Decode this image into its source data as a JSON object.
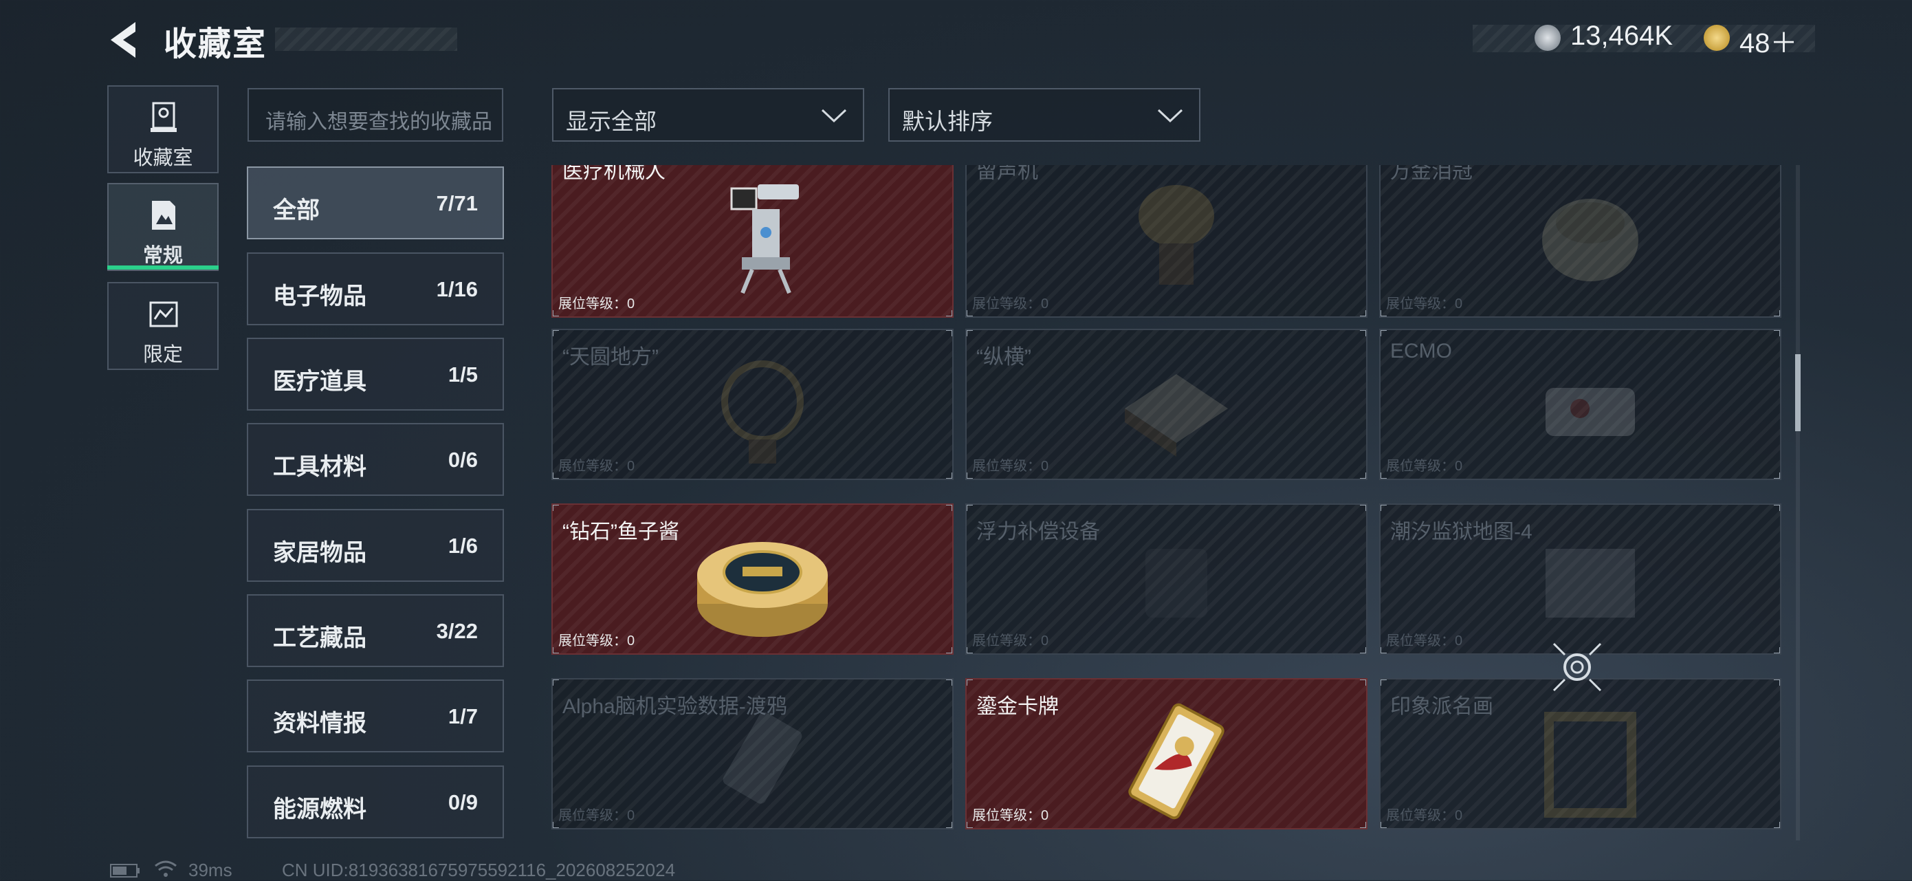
{
  "header": {
    "title": "收藏室",
    "currency_silver": "13,464K",
    "currency_gold": "48＋"
  },
  "nav": {
    "tabs": [
      {
        "label": "收藏室",
        "icon": "collection-room-icon"
      },
      {
        "label": "常规",
        "icon": "regular-icon",
        "active": true
      },
      {
        "label": "限定",
        "icon": "limited-icon"
      }
    ]
  },
  "search": {
    "placeholder": "请输入想要查找的收藏品"
  },
  "filters": {
    "display": "显示全部",
    "sort": "默认排序"
  },
  "categories": [
    {
      "name": "全部",
      "count": "7/71",
      "active": true
    },
    {
      "name": "电子物品",
      "count": "1/16"
    },
    {
      "name": "医疗道具",
      "count": "1/5"
    },
    {
      "name": "工具材料",
      "count": "0/6"
    },
    {
      "name": "家居物品",
      "count": "1/6"
    },
    {
      "name": "工艺藏品",
      "count": "3/22"
    },
    {
      "name": "资料情报",
      "count": "1/7"
    },
    {
      "name": "能源燃料",
      "count": "0/9"
    }
  ],
  "grid": {
    "level_label": "展位等级：0",
    "items": [
      {
        "title": "医疗机械人",
        "owned": true
      },
      {
        "title": "留声机",
        "owned": false
      },
      {
        "title": "万金泪冠",
        "owned": false
      },
      {
        "title": "“天圆地方”",
        "owned": false
      },
      {
        "title": "“纵横”",
        "owned": false
      },
      {
        "title": "ECMO",
        "owned": false
      },
      {
        "title": "“钻石”鱼子酱",
        "owned": true
      },
      {
        "title": "浮力补偿设备",
        "owned": false
      },
      {
        "title": "潮汐监狱地图-4",
        "owned": false
      },
      {
        "title": "Alpha脑机实验数据-渡鸦",
        "owned": false
      },
      {
        "title": "鎏金卡牌",
        "owned": true
      },
      {
        "title": "印象派名画",
        "owned": false
      }
    ]
  },
  "status": {
    "ping": "39ms",
    "uid": "CN UID:81936381675975592116_202608252024"
  },
  "colors": {
    "owned_card": "#4a1c20",
    "active_tab_underline": "#2bd08b",
    "background": "#1b242d"
  }
}
